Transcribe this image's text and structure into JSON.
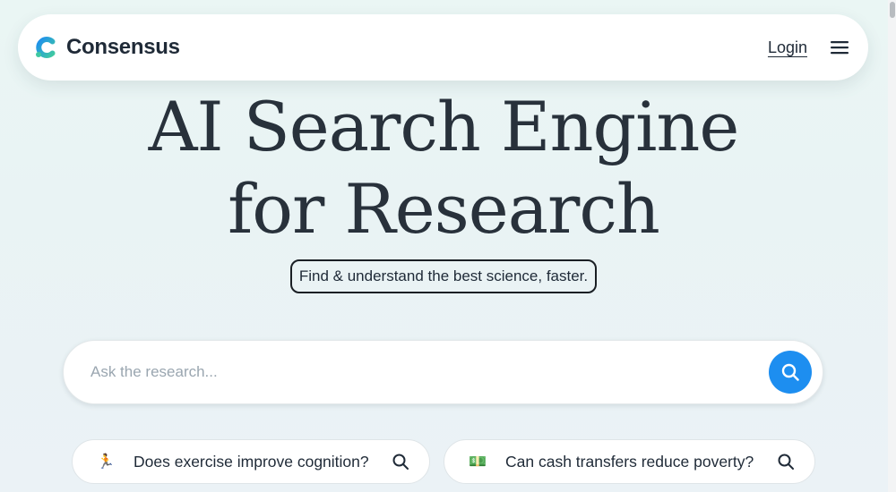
{
  "header": {
    "brand_name": "Consensus",
    "login_label": "Login",
    "menu_icon": "hamburger-menu-icon"
  },
  "hero": {
    "title_line_1": "AI Search Engine",
    "title_line_2": "for Research",
    "tagline": "Find & understand the best science, faster."
  },
  "search": {
    "placeholder": "Ask the research...",
    "value": "",
    "button_icon": "search-icon",
    "accent_color": "#1d8ef0"
  },
  "suggestions": [
    {
      "emoji": "🏃",
      "icon": "runner-emoji-icon",
      "text": "Does exercise improve cognition?"
    },
    {
      "emoji": "💵",
      "icon": "dollar-bill-emoji-icon",
      "text": "Can cash transfers reduce poverty?"
    }
  ],
  "colors": {
    "brand_blue": "#1d8ef0",
    "brand_green": "#3fc8a2",
    "text_dark": "#28313b"
  }
}
